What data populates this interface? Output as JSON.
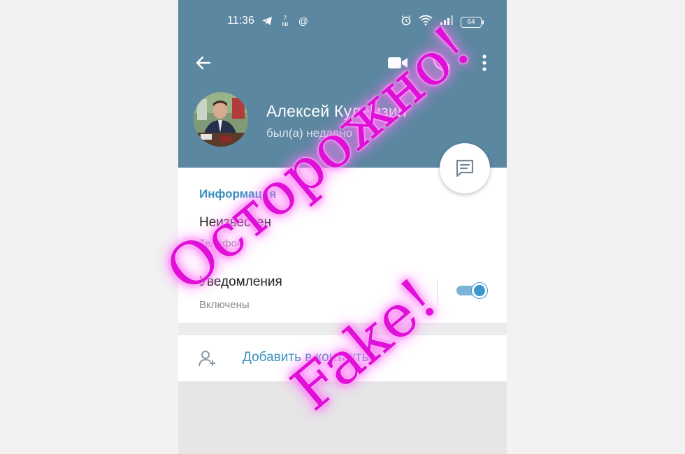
{
  "status_bar": {
    "time": "11:36",
    "battery": "64"
  },
  "profile": {
    "name": "Алексей Кулемзин",
    "last_seen": "был(а) недавно"
  },
  "info": {
    "section_title": "Информация",
    "phone_value": "Неизвестен",
    "phone_label": "Телефон",
    "notifications_title": "Уведомления",
    "notifications_state": "Включены",
    "notifications_enabled": true
  },
  "actions": {
    "add_contact": "Добавить в контакты"
  },
  "overlay": {
    "warning": "Осторожно!",
    "fake": "Fake!"
  },
  "colors": {
    "header": "#5b87a0",
    "accent": "#3a8fc0",
    "overlay_text": "#e010d8"
  }
}
